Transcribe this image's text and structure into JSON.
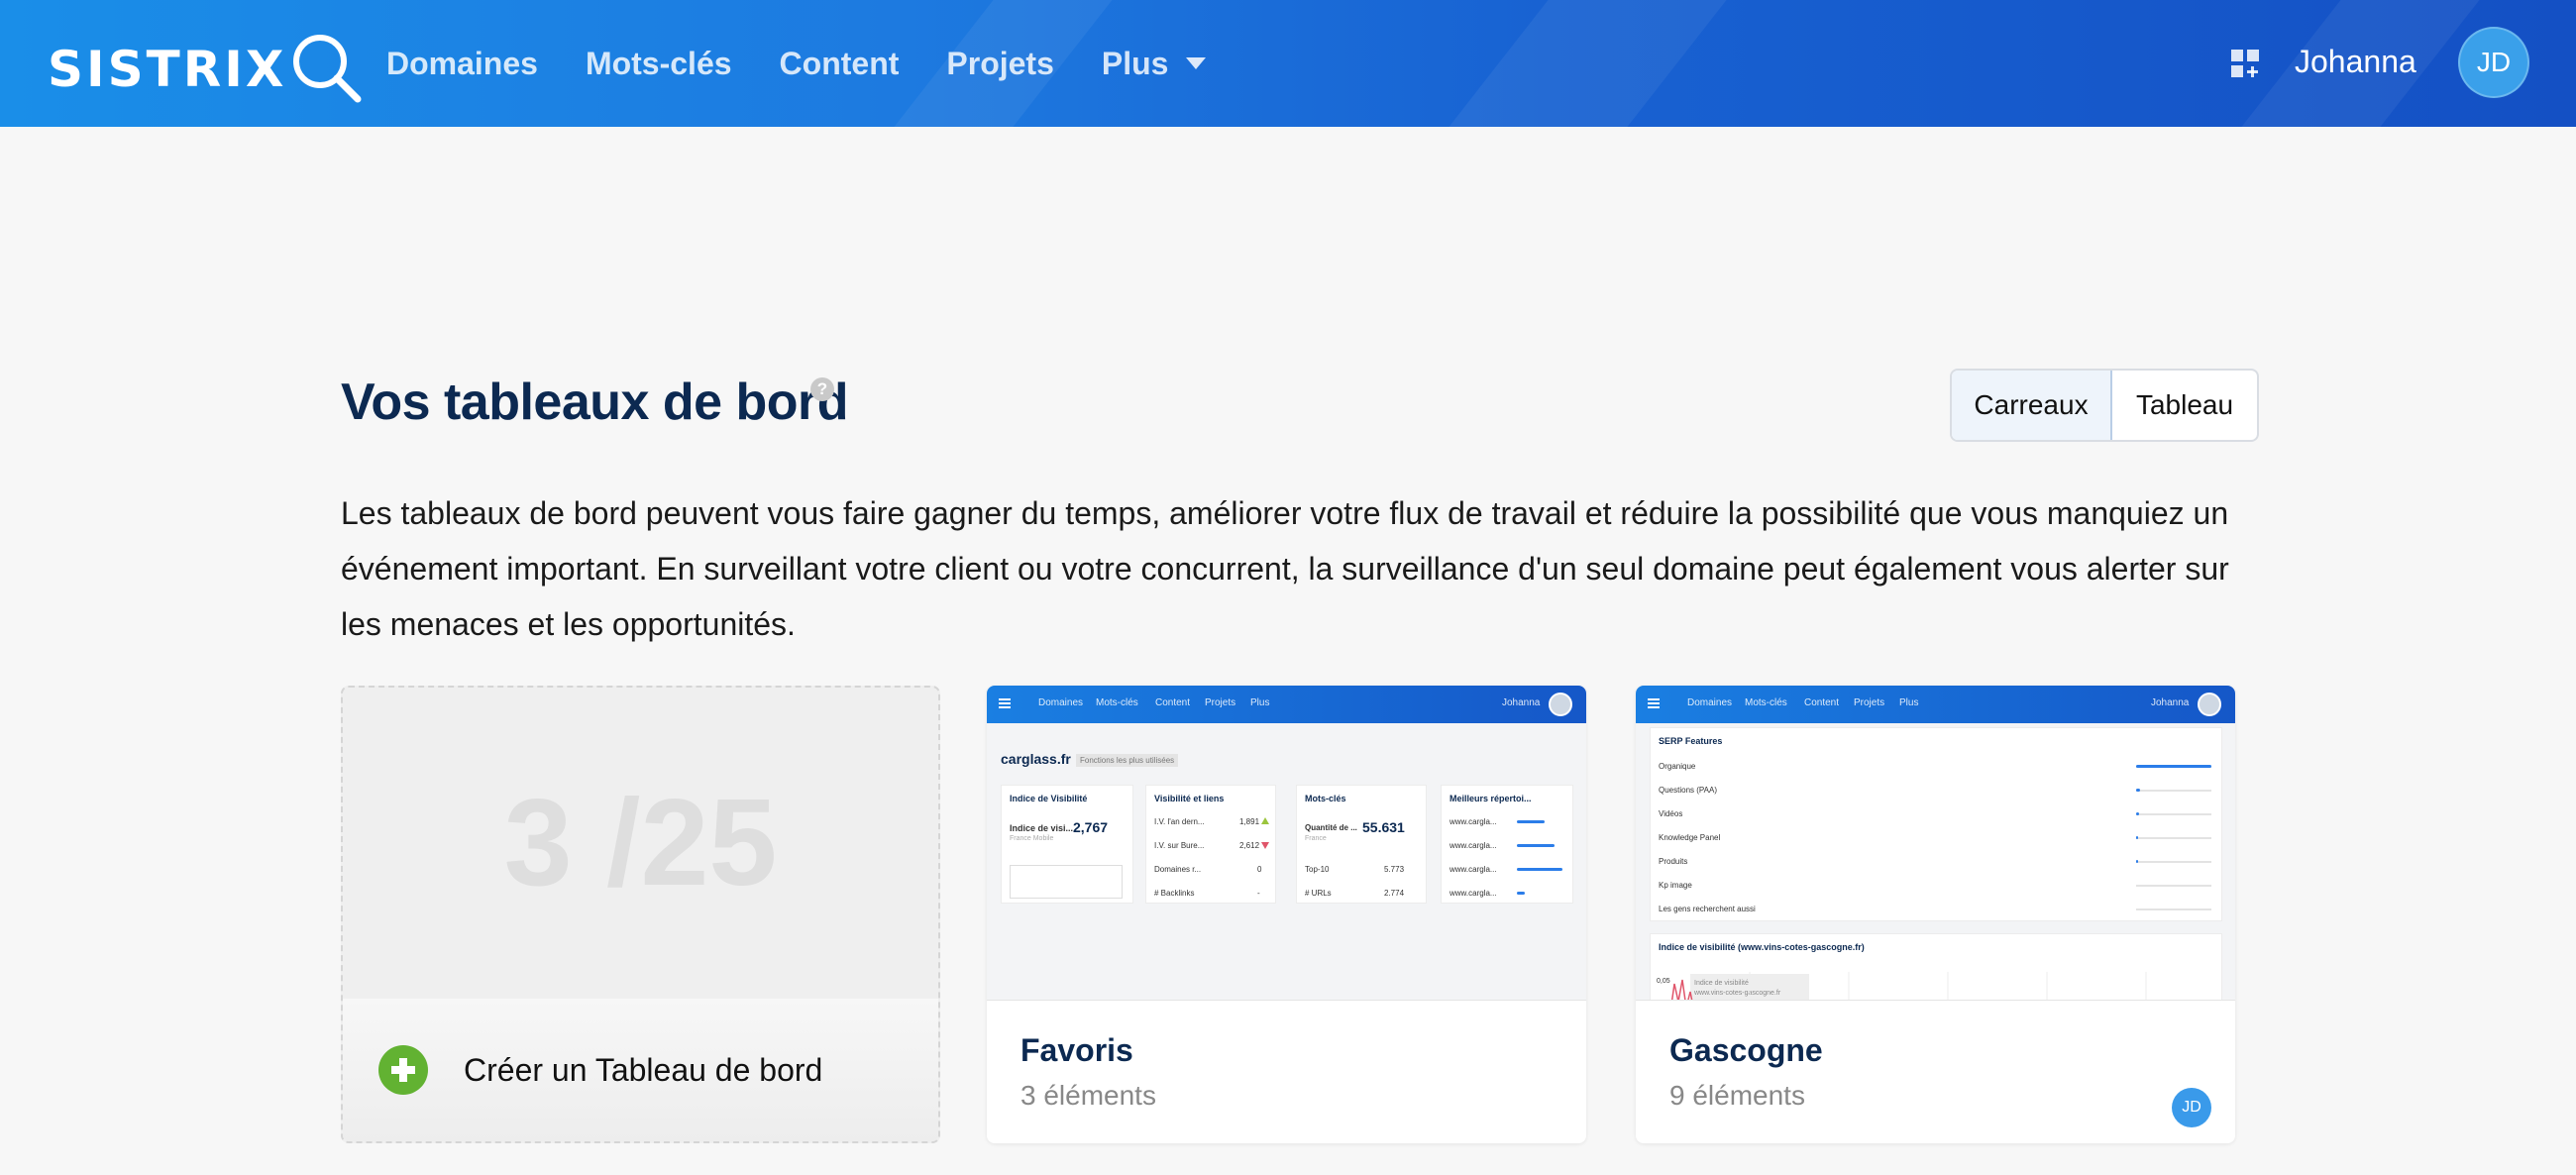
{
  "header": {
    "logo_text": "SISTRIX",
    "nav": [
      "Domaines",
      "Mots-clés",
      "Content",
      "Projets",
      "Plus"
    ],
    "username": "Johanna",
    "avatar_initials": "JD",
    "colors": {
      "bar_start": "#1a8ee8",
      "bar_end": "#1450c4"
    }
  },
  "page": {
    "title": "Vos tableaux de bord",
    "help": "?",
    "view_toggle": {
      "active": "Carreaux",
      "other": "Tableau"
    },
    "intro": "Les tableaux de bord peuvent vous faire gagner du temps, améliorer votre flux de travail et réduire la possibilité que vous manquiez un événement important. En surveillant votre client ou votre concurrent, la surveillance d'un seul domaine peut également vous alerter sur les menaces et les opportunités."
  },
  "cards": {
    "new": {
      "counter": "3 /25",
      "label": "Créer un Tableau de bord",
      "accent": "#62b232"
    },
    "favoris": {
      "title": "Favoris",
      "subtitle": "3 éléments",
      "preview": {
        "nav": [
          "Domaines",
          "Mots-clés",
          "Content",
          "Projets",
          "Plus"
        ],
        "user": "Johanna",
        "domain": "carglass.fr",
        "tag": "Fonctions les plus utilisées",
        "box1_title": "Indice de Visibilité",
        "box1_label": "Indice de visi...",
        "box1_value": "2,767",
        "box1_sub": "France Mobile",
        "box2_title": "Visibilité et liens",
        "box2_rows": [
          {
            "label": "I.V. l'an dern...",
            "value": "1,891"
          },
          {
            "label": "I.V. sur Bure...",
            "value": "2,612"
          },
          {
            "label": "Domaines r...",
            "value": "0"
          },
          {
            "label": "# Backlinks",
            "value": "-"
          }
        ],
        "box3_title": "Mots-clés",
        "box3_label": "Quantité de ...",
        "box3_value": "55.631",
        "box3_sub": "France",
        "box3_rows": [
          {
            "label": "Top-10",
            "value": "5.773"
          },
          {
            "label": "# URLs",
            "value": "2.774"
          }
        ],
        "box4_title": "Meilleurs répertoi...",
        "box4_rows": [
          "www.cargla...",
          "www.cargla...",
          "www.cargla...",
          "www.cargla..."
        ]
      }
    },
    "gascogne": {
      "title": "Gascogne",
      "subtitle": "9 éléments",
      "owner_initials": "JD",
      "preview": {
        "nav": [
          "Domaines",
          "Mots-clés",
          "Content",
          "Projets",
          "Plus"
        ],
        "user": "Johanna",
        "serp_title": "SERP Features",
        "serp_rows": [
          "Organique",
          "Questions (PAA)",
          "Vidéos",
          "Knowledge Panel",
          "Produits",
          "Kp image",
          "Les gens recherchent aussi"
        ],
        "vis_title": "Indice de visibilité (www.vins-cotes-gascogne.fr)",
        "vis_value": "0,05",
        "vis_legend": "Indice de visibilité",
        "vis_domain": "www.vins-cotes-gascogne.fr"
      }
    }
  }
}
